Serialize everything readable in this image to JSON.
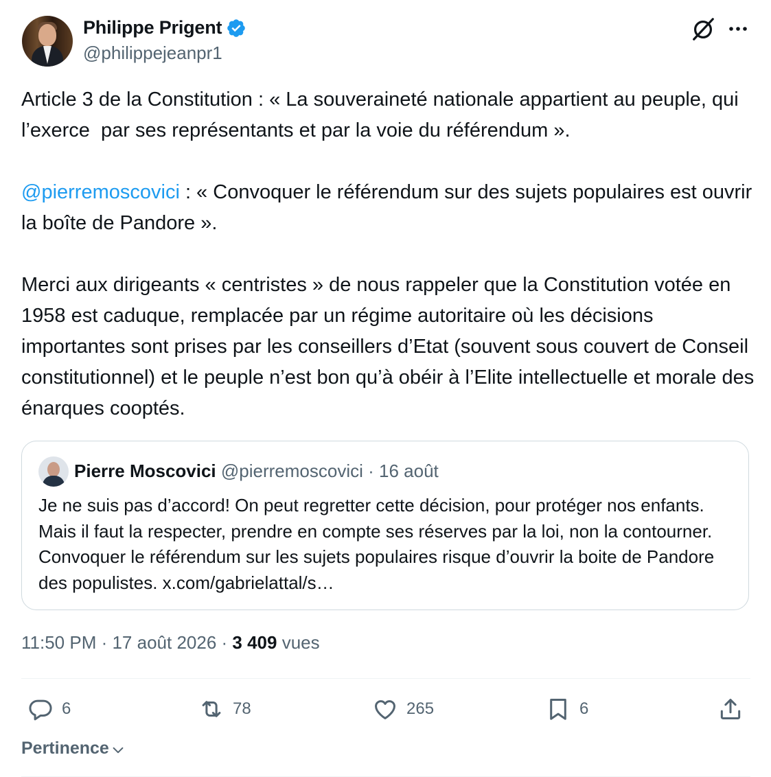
{
  "author": {
    "display_name": "Philippe Prigent",
    "handle": "@philippejeanpr1",
    "verified": true,
    "verified_color": "#1d9bf0"
  },
  "tweet": {
    "paragraphs": [
      {
        "text": "Article 3 de la Constitution : « La souveraineté nationale appartient au peuple, qui l’exerce  par ses représentants et par la voie du référendum »."
      },
      {
        "mention": "@pierremoscovici",
        "text": " : « Convoquer le référendum sur des sujets populaires est ouvrir la boîte de Pandore »."
      },
      {
        "text": "Merci aux dirigeants « centristes » de nous rappeler que la Constitution votée en 1958 est caduque, remplacée par un régime autoritaire où les décisions importantes sont prises par les conseillers d’Etat (souvent sous couvert de Conseil constitutionnel) et le peuple n’est bon qu’à obéir à l’Elite intellectuelle et morale des énarques cooptés."
      }
    ]
  },
  "quote": {
    "display_name": "Pierre Moscovici",
    "handle": "@pierremoscovici",
    "separator": " · ",
    "date": "16 août",
    "text": "Je ne suis pas d’accord! On peut regretter cette décision, pour protéger nos enfants. Mais il faut la respecter, prendre en compte ses réserves par la loi, non la contourner. Convoquer le référendum sur les sujets populaires risque d’ouvrir la boite de Pandore des populistes. x.com/gabrielattal/s…"
  },
  "meta": {
    "time": "11:50 PM",
    "sep1": " · ",
    "date": "17 août 2026",
    "sep2": " · ",
    "views": "3 409",
    "views_label": " vues"
  },
  "actions": {
    "replies": "6",
    "reposts": "78",
    "likes": "265",
    "bookmarks": "6"
  },
  "sort": {
    "label": "Pertinence"
  },
  "colors": {
    "text": "#0f1419",
    "secondary": "#536471",
    "link": "#1d9bf0",
    "border": "#cfd9de"
  }
}
